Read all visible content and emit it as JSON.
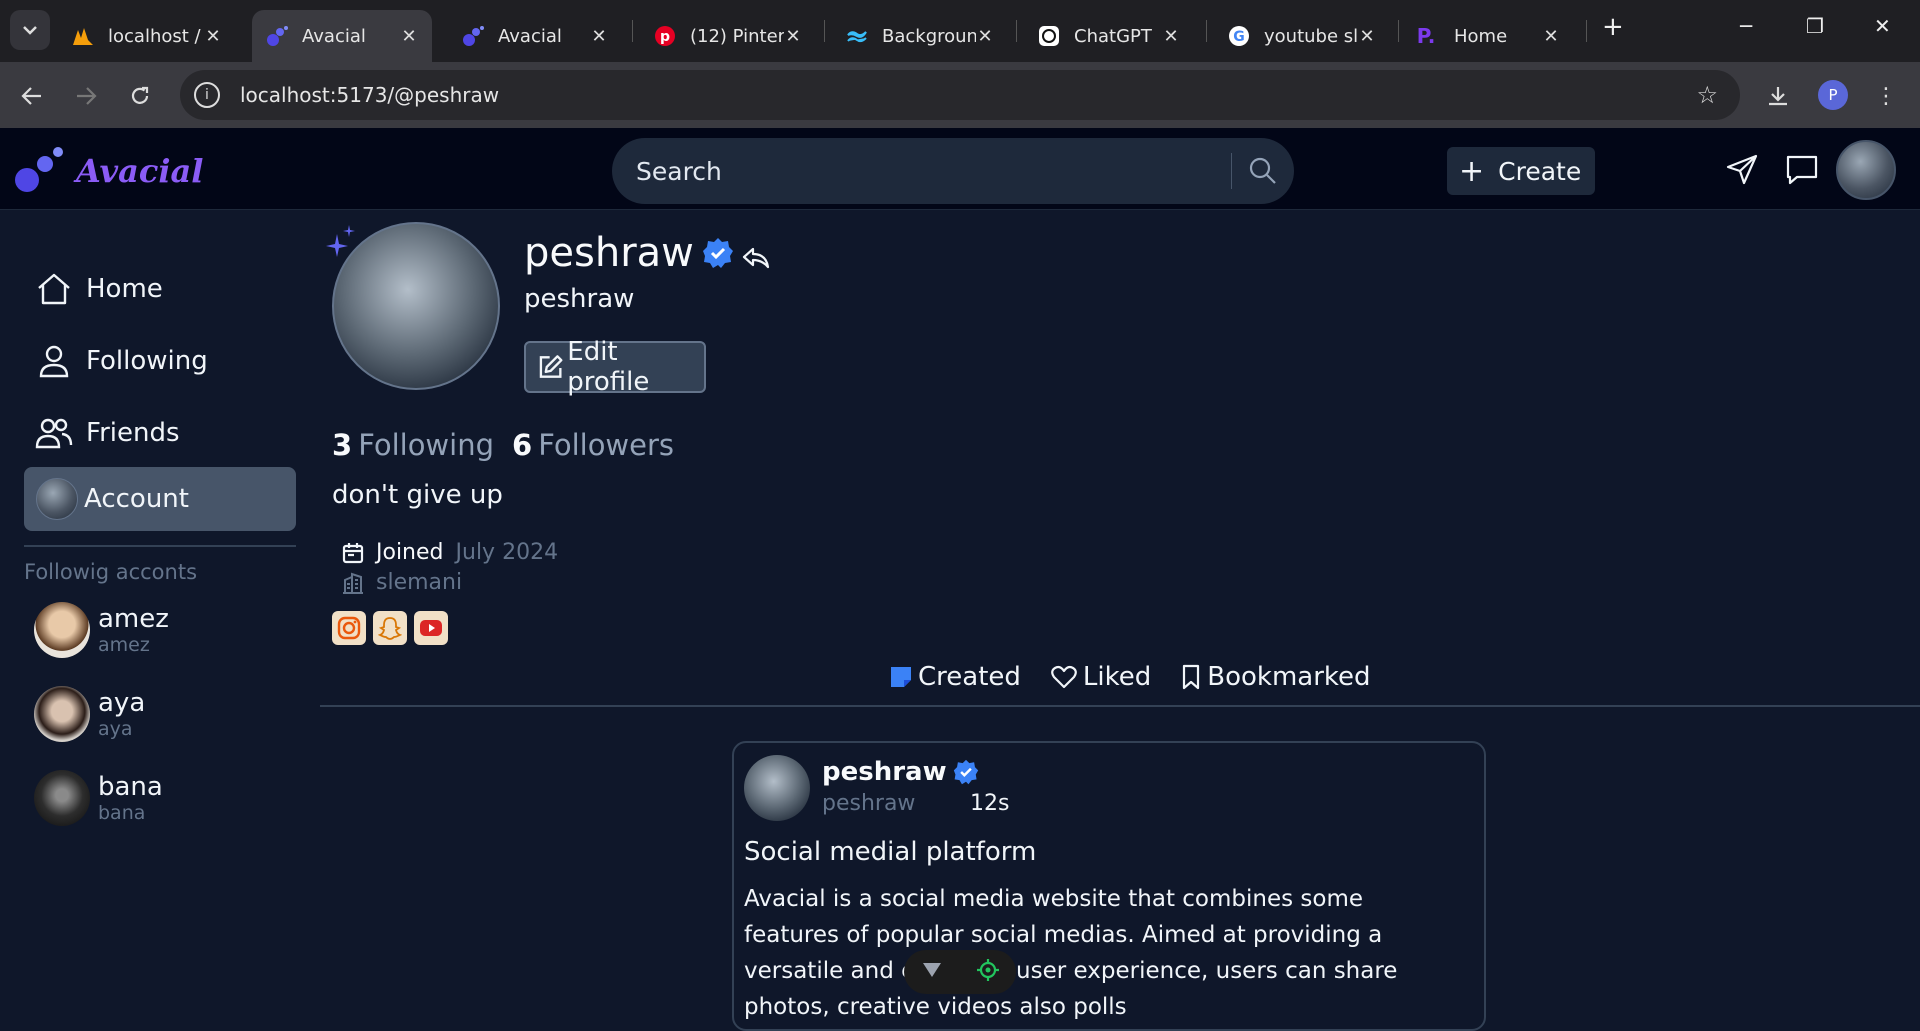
{
  "browser": {
    "tabs": [
      {
        "label": "localhost /",
        "icon": "pma-icon"
      },
      {
        "label": "Avacial",
        "icon": "avacial-icon",
        "active": true
      },
      {
        "label": "Avacial",
        "icon": "avacial-icon"
      },
      {
        "label": "(12) Pinter",
        "icon": "pinterest-icon"
      },
      {
        "label": "Backgroun",
        "icon": "tailwind-icon"
      },
      {
        "label": "ChatGPT",
        "icon": "chatgpt-icon"
      },
      {
        "label": "youtube sl",
        "icon": "google-icon"
      },
      {
        "label": "Home",
        "icon": "p-icon"
      }
    ],
    "url": "localhost:5173/@peshraw",
    "profile_initial": "P"
  },
  "header": {
    "logo_text": "Avacial",
    "search_placeholder": "Search",
    "create_label": "Create"
  },
  "sidebar": {
    "items": [
      {
        "label": "Home",
        "icon": "home-icon"
      },
      {
        "label": "Following",
        "icon": "user-icon"
      },
      {
        "label": "Friends",
        "icon": "users-icon"
      },
      {
        "label": "Account",
        "icon": "avatar",
        "active": true
      }
    ],
    "following_heading": "Followig acconts",
    "following": [
      {
        "name": "amez",
        "handle": "amez"
      },
      {
        "name": "aya",
        "handle": "aya"
      },
      {
        "name": "bana",
        "handle": "bana"
      }
    ]
  },
  "profile": {
    "name": "peshraw",
    "handle": "peshraw",
    "edit_label": "Edit profile",
    "following_count": "3",
    "following_label": "Following",
    "followers_count": "6",
    "followers_label": "Followers",
    "bio": "don't give up",
    "joined_label": "Joined",
    "joined_date": "July 2024",
    "location": "slemani",
    "socials": [
      "instagram-icon",
      "snapchat-icon",
      "youtube-icon"
    ]
  },
  "tabs": [
    {
      "label": "Created",
      "icon": "note-icon"
    },
    {
      "label": "Liked",
      "icon": "heart-icon"
    },
    {
      "label": "Bookmarked",
      "icon": "bookmark-icon"
    }
  ],
  "post": {
    "name": "peshraw",
    "handle": "peshraw",
    "time": "12s",
    "title": "Social medial platform",
    "body": "Avacial is a social media website that combines some features of popular social medias. Aimed at providing a versatile and engaging user experience, users can share photos, creative videos also polls"
  },
  "colors": {
    "accent": "#8b5cf6",
    "verified": "#3b82f6",
    "background": "#0f172a",
    "header": "#020617"
  }
}
